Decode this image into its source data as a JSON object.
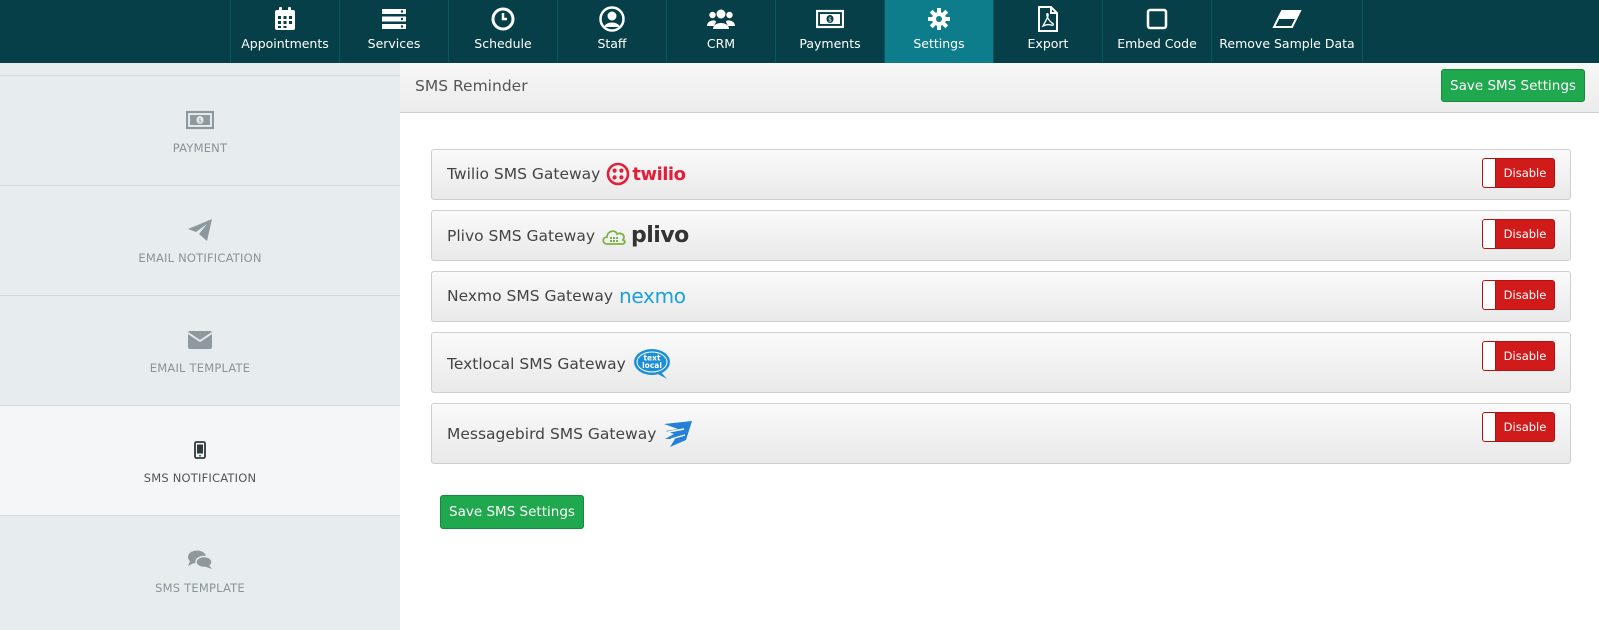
{
  "nav": {
    "items": [
      {
        "label": "Appointments",
        "icon": "calendar-icon"
      },
      {
        "label": "Services",
        "icon": "server-icon"
      },
      {
        "label": "Schedule",
        "icon": "clock-icon"
      },
      {
        "label": "Staff",
        "icon": "user-circle-icon"
      },
      {
        "label": "CRM",
        "icon": "users-icon"
      },
      {
        "label": "Payments",
        "icon": "money-icon"
      },
      {
        "label": "Settings",
        "icon": "gear-icon"
      },
      {
        "label": "Export",
        "icon": "pdf-icon"
      },
      {
        "label": "Embed Code",
        "icon": "square-icon"
      },
      {
        "label": "Remove Sample Data",
        "icon": "eraser-icon"
      }
    ],
    "active": "Settings"
  },
  "sidebar": {
    "items": [
      {
        "label": "PAYMENT",
        "icon": "money-icon"
      },
      {
        "label": "EMAIL NOTIFICATION",
        "icon": "paper-plane-icon"
      },
      {
        "label": "EMAIL TEMPLATE",
        "icon": "envelope-icon"
      },
      {
        "label": "SMS NOTIFICATION",
        "icon": "mobile-icon"
      },
      {
        "label": "SMS TEMPLATE",
        "icon": "comments-icon"
      }
    ],
    "active": "SMS NOTIFICATION"
  },
  "panel": {
    "title": "SMS Reminder",
    "save_label": "Save SMS Settings",
    "save_bottom_label": "Save SMS Settings"
  },
  "gateways": [
    {
      "title": "Twilio SMS Gateway",
      "logo_text": "twilio",
      "toggle": "Disable"
    },
    {
      "title": "Plivo SMS Gateway",
      "logo_text": "plivo",
      "toggle": "Disable"
    },
    {
      "title": "Nexmo SMS Gateway",
      "logo_text": "nexmo",
      "toggle": "Disable"
    },
    {
      "title": "Textlocal SMS Gateway",
      "logo_text": "text local",
      "toggle": "Disable"
    },
    {
      "title": "Messagebird SMS Gateway",
      "logo_text": "",
      "toggle": "Disable"
    }
  ],
  "colors": {
    "nav_bg": "#063f47",
    "nav_active": "#0d7d8c",
    "save_green": "#1fa84d",
    "toggle_red": "#d11a1a",
    "twilio_red": "#e31e38",
    "plivo_green": "#7bb342",
    "nexmo_blue": "#1ba0d8"
  }
}
